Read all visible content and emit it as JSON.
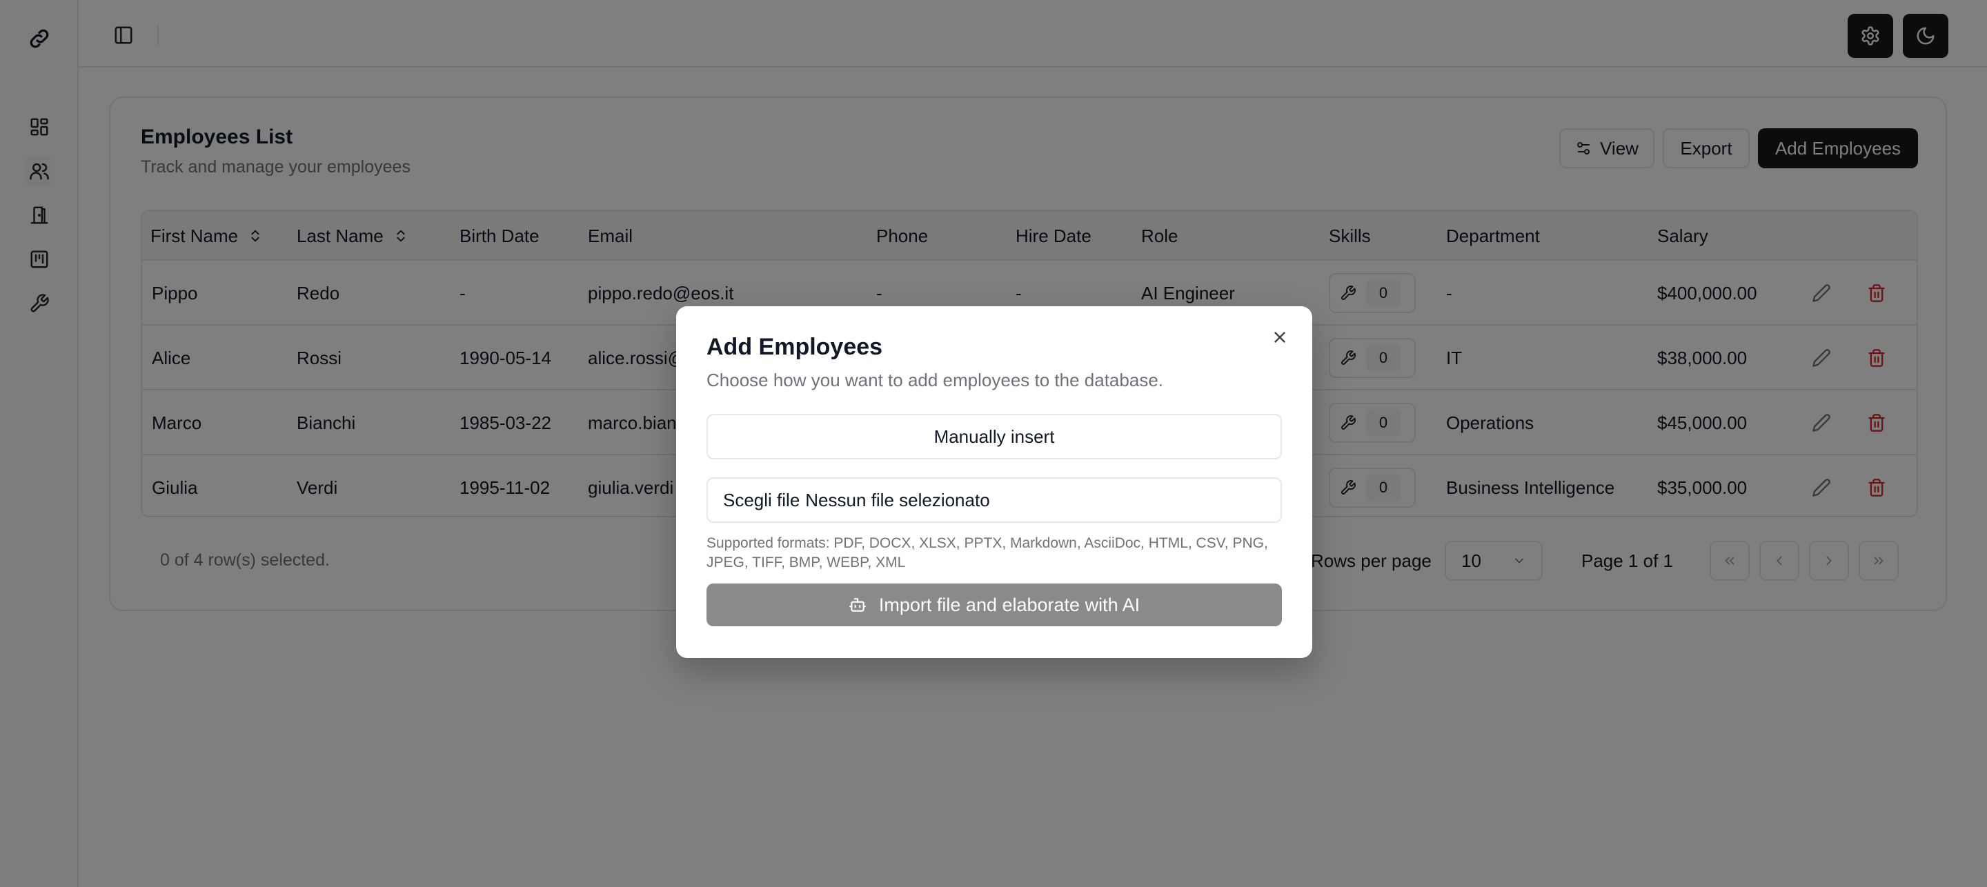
{
  "topbar": {
    "settings_icon": "gear-icon",
    "theme_icon": "moon-icon"
  },
  "sidebar": {
    "items": [
      {
        "icon": "dashboard-icon"
      },
      {
        "icon": "users-icon"
      },
      {
        "icon": "door-icon"
      },
      {
        "icon": "board-icon"
      },
      {
        "icon": "wrench-icon"
      }
    ]
  },
  "page": {
    "title": "Employees List",
    "subtitle": "Track and manage your employees",
    "view_label": "View",
    "export_label": "Export",
    "add_label": "Add Employees"
  },
  "table": {
    "columns": {
      "first_name": "First Name",
      "last_name": "Last Name",
      "birth_date": "Birth Date",
      "email": "Email",
      "phone": "Phone",
      "hire_date": "Hire Date",
      "role": "Role",
      "skills": "Skills",
      "department": "Department",
      "salary": "Salary"
    },
    "rows": [
      {
        "first_name": "Pippo",
        "last_name": "Redo",
        "birth_date": "-",
        "email": "pippo.redo@eos.it",
        "phone": "-",
        "hire_date": "-",
        "role": "AI Engineer",
        "skills": "0",
        "department": "-",
        "salary": "$400,000.00"
      },
      {
        "first_name": "Alice",
        "last_name": "Rossi",
        "birth_date": "1990-05-14",
        "email": "alice.rossi@",
        "phone": "",
        "hire_date": "",
        "role": "",
        "skills": "0",
        "department": "IT",
        "salary": "$38,000.00"
      },
      {
        "first_name": "Marco",
        "last_name": "Bianchi",
        "birth_date": "1985-03-22",
        "email": "marco.bian",
        "phone": "",
        "hire_date": "",
        "role": "",
        "skills": "0",
        "department": "Operations",
        "salary": "$45,000.00"
      },
      {
        "first_name": "Giulia",
        "last_name": "Verdi",
        "birth_date": "1995-11-02",
        "email": "giulia.verdi",
        "phone": "",
        "hire_date": "",
        "role": "",
        "skills": "0",
        "department": "Business Intelligence",
        "salary": "$35,000.00"
      }
    ]
  },
  "footer": {
    "selected": "0 of 4 row(s) selected.",
    "rows_per_page_label": "Rows per page",
    "rows_per_page_value": "10",
    "page_label": "Page 1 of 1"
  },
  "modal": {
    "title": "Add Employees",
    "description": "Choose how you want to add employees to the database.",
    "manual_label": "Manually insert",
    "choose_file_label": "Scegli file",
    "no_file_label": "Nessun file selezionato",
    "formats": "Supported formats: PDF, DOCX, XLSX, PPTX, Markdown, AsciiDoc, HTML, CSV, PNG, JPEG, TIFF, BMP, WEBP, XML",
    "import_label": "Import file and elaborate with AI"
  }
}
